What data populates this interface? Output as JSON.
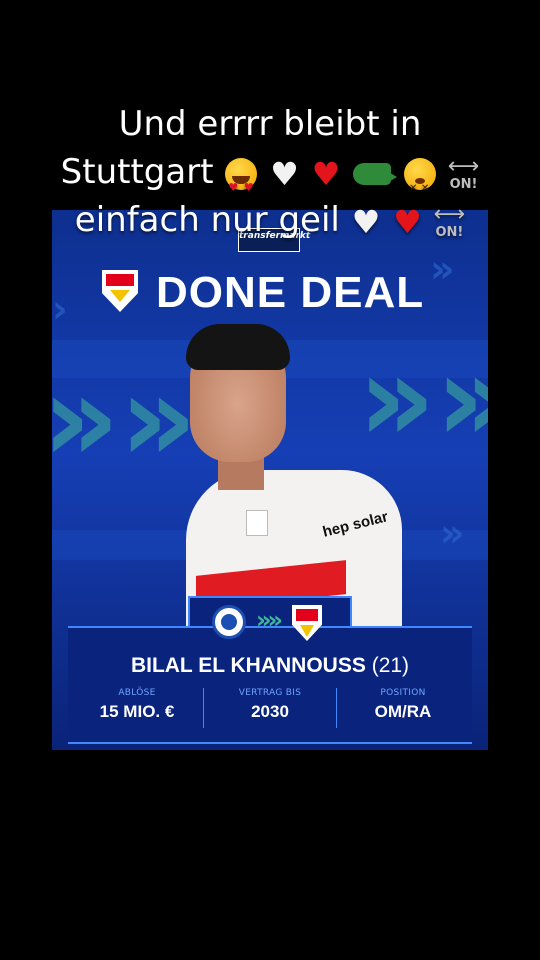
{
  "caption": {
    "line1": "Und errrr bleibt in",
    "line2": "Stuttgart",
    "line3": "einfach nur geil",
    "on_badge": "ON!"
  },
  "card": {
    "brand_logo": "transfermarkt",
    "headline": "DONE DEAL",
    "club_from": "leicester-city-crest-icon",
    "club_to": "vfb-stuttgart-crest-icon",
    "player_name": "BILAL EL KHANNOUSS",
    "player_age": "(21)",
    "sponsor": "hep solar",
    "stats": [
      {
        "label": "ABLÖSE",
        "value": "15 MIO. €"
      },
      {
        "label": "VERTRAG BIS",
        "value": "2030"
      },
      {
        "label": "POSITION",
        "value": "OM/RA"
      }
    ]
  },
  "colors": {
    "background": "#000000",
    "card_blue": "#163fb5",
    "accent_green": "#3fb99a",
    "accent_blue_line": "#3f86ff",
    "stat_label": "#6fa4ff"
  }
}
